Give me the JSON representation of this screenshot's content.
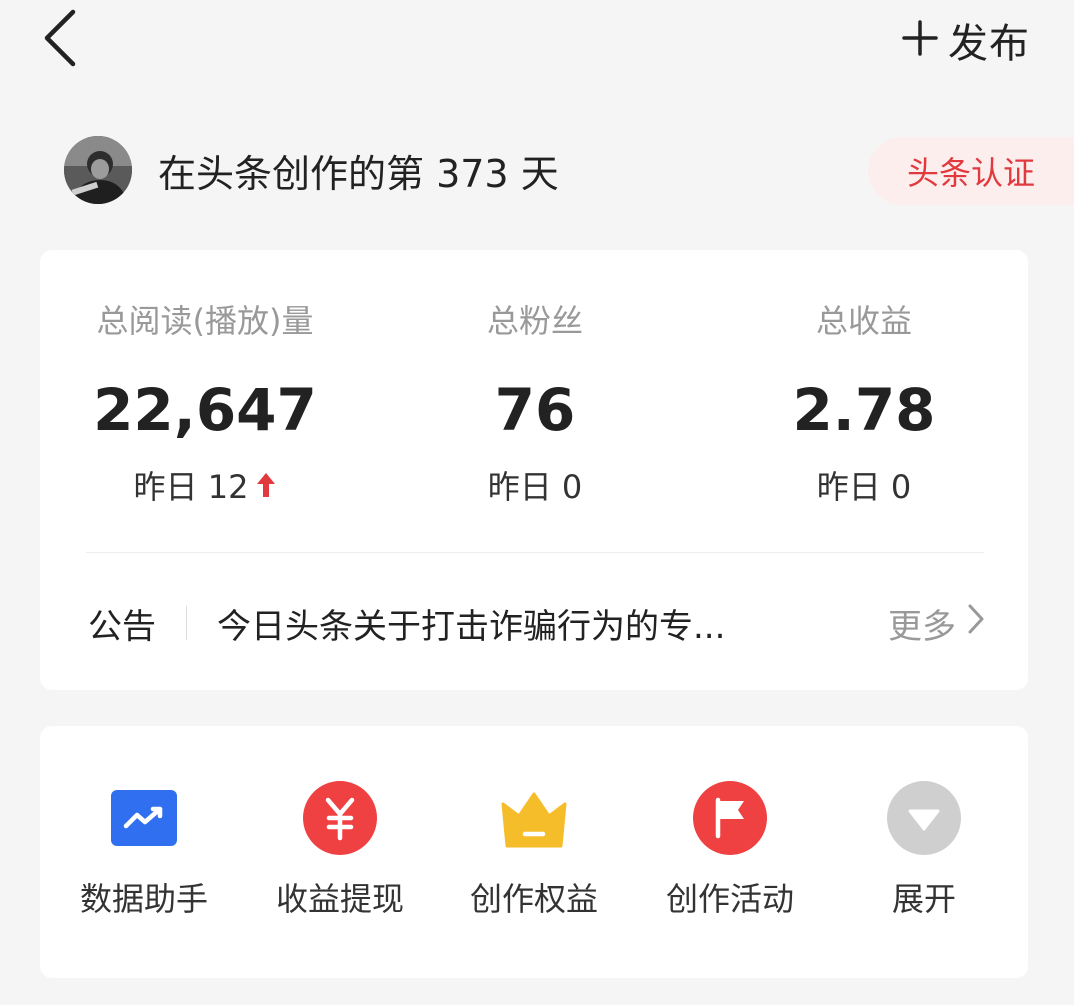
{
  "header": {
    "back_icon": "chevron-left-icon",
    "publish_icon": "plus-icon",
    "publish_label": "发布"
  },
  "profile": {
    "avatar_icon": "user-avatar",
    "creation_text": "在头条创作的第 373 天",
    "verify_label": "头条认证"
  },
  "stats": {
    "items": [
      {
        "label": "总阅读(播放)量",
        "value": "22,647",
        "yesterday": "昨日 12",
        "trend_icon": "arrow-up-icon"
      },
      {
        "label": "总粉丝",
        "value": "76",
        "yesterday": "昨日 0"
      },
      {
        "label": "总收益",
        "value": "2.78",
        "yesterday": "昨日 0"
      }
    ]
  },
  "notice": {
    "title": "公告",
    "text": "今日头条关于打击诈骗行为的专...",
    "more_label": "更多",
    "more_icon": "chevron-right-icon"
  },
  "tools": [
    {
      "label": "数据助手",
      "icon": "chart-trend-icon"
    },
    {
      "label": "收益提现",
      "icon": "yuan-icon"
    },
    {
      "label": "创作权益",
      "icon": "crown-icon"
    },
    {
      "label": "创作活动",
      "icon": "flag-icon"
    },
    {
      "label": "展开",
      "icon": "expand-down-icon"
    }
  ],
  "colors": {
    "accent_red": "#e1393d",
    "data_blue": "#2f6ff0",
    "crown_yellow": "#f6bd2b",
    "expand_gray": "#cfcfcf"
  }
}
